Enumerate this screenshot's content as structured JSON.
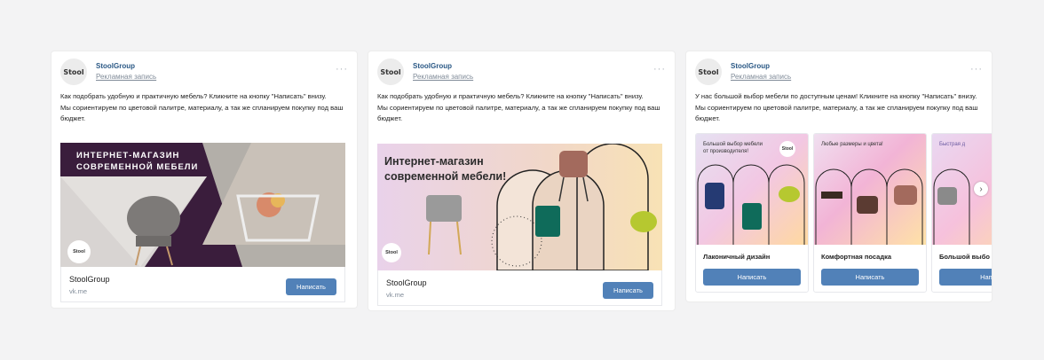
{
  "posts": [
    {
      "avatar_text": "Stool",
      "name": "StoolGroup",
      "subtitle": "Рекламная запись",
      "text": "Как подобрать удобную и практичную мебель? Кликните на кнопку \"Написать\" внизу.\nМы сориентируем по цветовой палитре, материалу, а так же спланируем покупку под ваш бюджет.",
      "banner": "ИНТЕРНЕТ-МАГАЗИН\nСОВРЕМЕННОЙ МЕБЕЛИ",
      "badge": "Stool",
      "footer_title": "StoolGroup",
      "footer_sub": "vk.me",
      "button": "Написать"
    },
    {
      "avatar_text": "Stool",
      "name": "StoolGroup",
      "subtitle": "Рекламная запись",
      "text": "Как подобрать удобную и практичную мебель? Кликните на кнопку \"Написать\" внизу.\nМы сориентируем по цветовой палитре, материалу, а так же спланируем покупку под ваш бюджет.",
      "banner": "Интернет-магазин\nсовременной мебели!",
      "badge": "Stool",
      "footer_title": "StoolGroup",
      "footer_sub": "vk.me",
      "button": "Написать"
    },
    {
      "avatar_text": "Stool",
      "name": "StoolGroup",
      "subtitle": "Рекламная запись",
      "text": "У нас большой выбор мебели по доступным ценам! Кликните на кнопку \"Написать\" внизу. Мы сориентируем по цветовой палитре, материалу, а так же спланируем покупку под ваш бюджет.",
      "slides": [
        {
          "tag": "Большой выбор мебели\nот производителя!",
          "label": "Лаконичный дизайн",
          "button": "Написать"
        },
        {
          "tag": "Любые размеры и цвета!",
          "label": "Комфортная посадка",
          "button": "Написать"
        },
        {
          "tag": "Быстрая д",
          "label": "Большой выбо",
          "button": "Напи"
        }
      ],
      "slide_badge": "Stool",
      "next_icon": "›"
    }
  ],
  "colors": {
    "link": "#2a5885",
    "button": "#5181b8",
    "muted": "#818c99"
  },
  "more_icon": "···"
}
